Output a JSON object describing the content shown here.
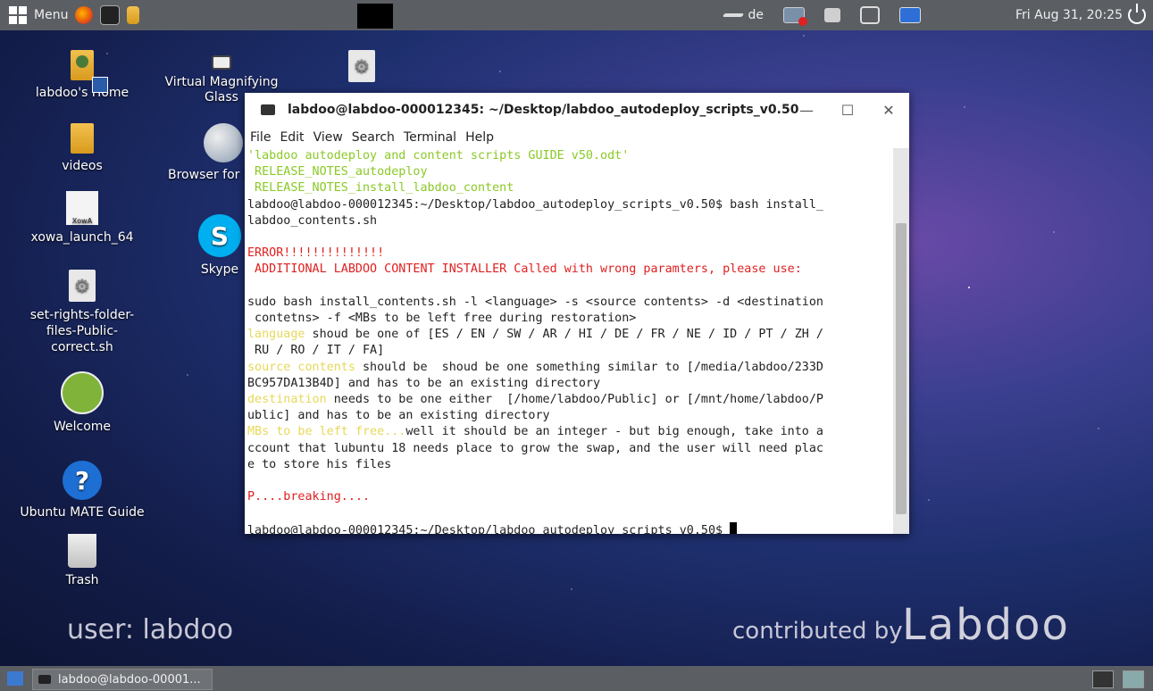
{
  "top_panel": {
    "menu_label": "Menu",
    "keyboard_layout": "de",
    "clock": "Fri Aug 31, 20:25"
  },
  "desktop_icons": [
    {
      "label": "labdoo's Home"
    },
    {
      "label": "Virtual Magnifying Glass"
    },
    {
      "label": "videos"
    },
    {
      "label": "Browser for l"
    },
    {
      "label": "xowa_launch_64"
    },
    {
      "label": "Skype"
    },
    {
      "label": "set-rights-folder-files-Public-correct.sh"
    },
    {
      "label": "Welcome"
    },
    {
      "label": "Ubuntu MATE Guide"
    },
    {
      "label": "Trash"
    }
  ],
  "xowa_badge": "XowA",
  "help_glyph": "?",
  "skype_glyph": "S",
  "watermark": {
    "user": "user: labdoo",
    "contributed": "contributed by",
    "brand": "Labdoo"
  },
  "terminal": {
    "title": "labdoo@labdoo-000012345: ~/Desktop/labdoo_autodeploy_scripts_v0.50",
    "menu": [
      "File",
      "Edit",
      "View",
      "Search",
      "Terminal",
      "Help"
    ],
    "lines": {
      "l1": "'labdoo autodeploy and content scripts GUIDE v50.odt'",
      "l2": " RELEASE_NOTES_autodeploy",
      "l3": " RELEASE_NOTES_install_labdoo_content",
      "l4": "labdoo@labdoo-000012345:~/Desktop/labdoo_autodeploy_scripts_v0.50$ bash install_",
      "l5": "labdoo_contents.sh",
      "l7": "ERROR!!!!!!!!!!!!!!",
      "l8": " ADDITIONAL LABDOO CONTENT INSTALLER Called with wrong paramters, please use:",
      "l10": "sudo bash install_contents.sh -l <language> -s <source contents> -d <destination",
      "l11": " contetns> -f <MBs to be left free during restoration>",
      "l12a": "language",
      "l12b": " shoud be one of [ES / EN / SW / AR / HI / DE / FR / NE / ID / PT / ZH /",
      "l13": " RU / RO / IT / FA]",
      "l14a": "source contents",
      "l14b": " should be  shoud be one something similar to [/media/labdoo/233D",
      "l15": "BC957DA13B4D] and has to be an existing directory",
      "l16a": "destination",
      "l16b": " needs to be one either  [/home/labdoo/Public] or [/mnt/home/labdoo/P",
      "l17": "ublic] and has to be an existing directory",
      "l18a": "MBs to be left free...",
      "l18b": "well it should be an integer - but big enough, take into a",
      "l19": "ccount that lubuntu 18 needs place to grow the swap, and the user will need plac",
      "l20": "e to store his files",
      "l22": "P....breaking....",
      "l24": "labdoo@labdoo-000012345:~/Desktop/labdoo_autodeploy_scripts_v0.50$ "
    }
  },
  "taskbar": {
    "item_label": "labdoo@labdoo-00001..."
  }
}
